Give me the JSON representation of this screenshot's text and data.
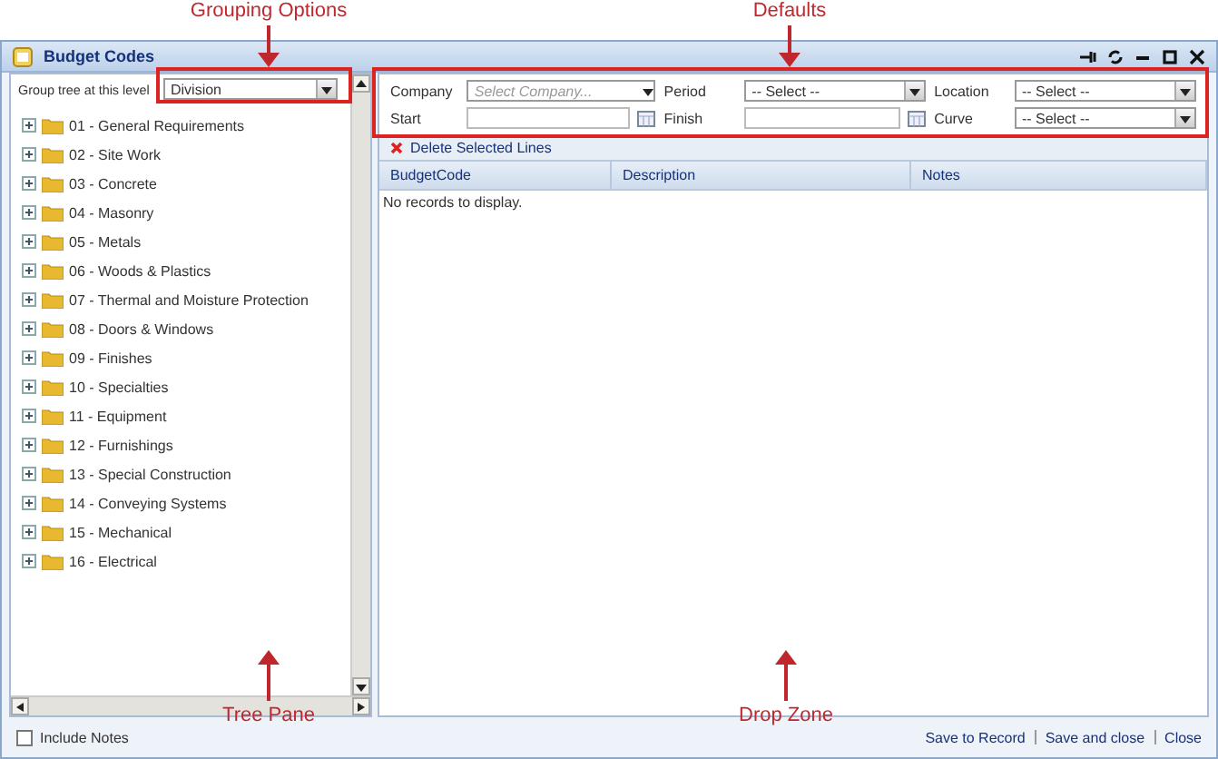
{
  "annotations": [
    {
      "label": "Grouping Options",
      "kind": "top"
    },
    {
      "label": "Defaults",
      "kind": "top"
    },
    {
      "label": "Tree Pane",
      "kind": "bottom"
    },
    {
      "label": "Drop Zone",
      "kind": "bottom"
    }
  ],
  "window": {
    "title": "Budget Codes"
  },
  "grouping": {
    "label": "Group tree at this level",
    "value": "Division"
  },
  "tree": {
    "items": [
      {
        "label": "01 - General Requirements",
        "expanded": false
      },
      {
        "label": "02 - Site Work",
        "expanded": false
      },
      {
        "label": "03 - Concrete",
        "expanded": false
      },
      {
        "label": "04 - Masonry",
        "expanded": false
      },
      {
        "label": "05 - Metals",
        "expanded": false
      },
      {
        "label": "06 - Woods & Plastics",
        "expanded": false
      },
      {
        "label": "07 - Thermal and Moisture Protection",
        "expanded": false
      },
      {
        "label": "08 - Doors & Windows",
        "expanded": false
      },
      {
        "label": "09 - Finishes",
        "expanded": false
      },
      {
        "label": "10 - Specialties",
        "expanded": false
      },
      {
        "label": "11 - Equipment",
        "expanded": false
      },
      {
        "label": "12 - Furnishings",
        "expanded": false
      },
      {
        "label": "13 - Special Construction",
        "expanded": false
      },
      {
        "label": "14 - Conveying Systems",
        "expanded": false
      },
      {
        "label": "15 - Mechanical",
        "expanded": false
      },
      {
        "label": "16 - Electrical",
        "expanded": false
      }
    ]
  },
  "defaults": [
    {
      "label": "Company",
      "kind": "combo",
      "placeholder": "Select Company..."
    },
    {
      "label": "Period",
      "kind": "select",
      "value": "-- Select --"
    },
    {
      "label": "Location",
      "kind": "select",
      "value": "-- Select --"
    },
    {
      "label": "Start",
      "kind": "date"
    },
    {
      "label": "Finish",
      "kind": "date"
    },
    {
      "label": "Curve",
      "kind": "select",
      "value": "-- Select --"
    }
  ],
  "toolbar": {
    "delete_button": "Delete Selected Lines"
  },
  "grid": {
    "columns": [
      "BudgetCode",
      "Description",
      "Notes"
    ],
    "empty_message": "No records to display."
  },
  "footer": {
    "include_notes": {
      "label": "Include Notes",
      "checked": false
    },
    "links": [
      "Save to Record",
      "Save and close",
      "Close"
    ]
  }
}
